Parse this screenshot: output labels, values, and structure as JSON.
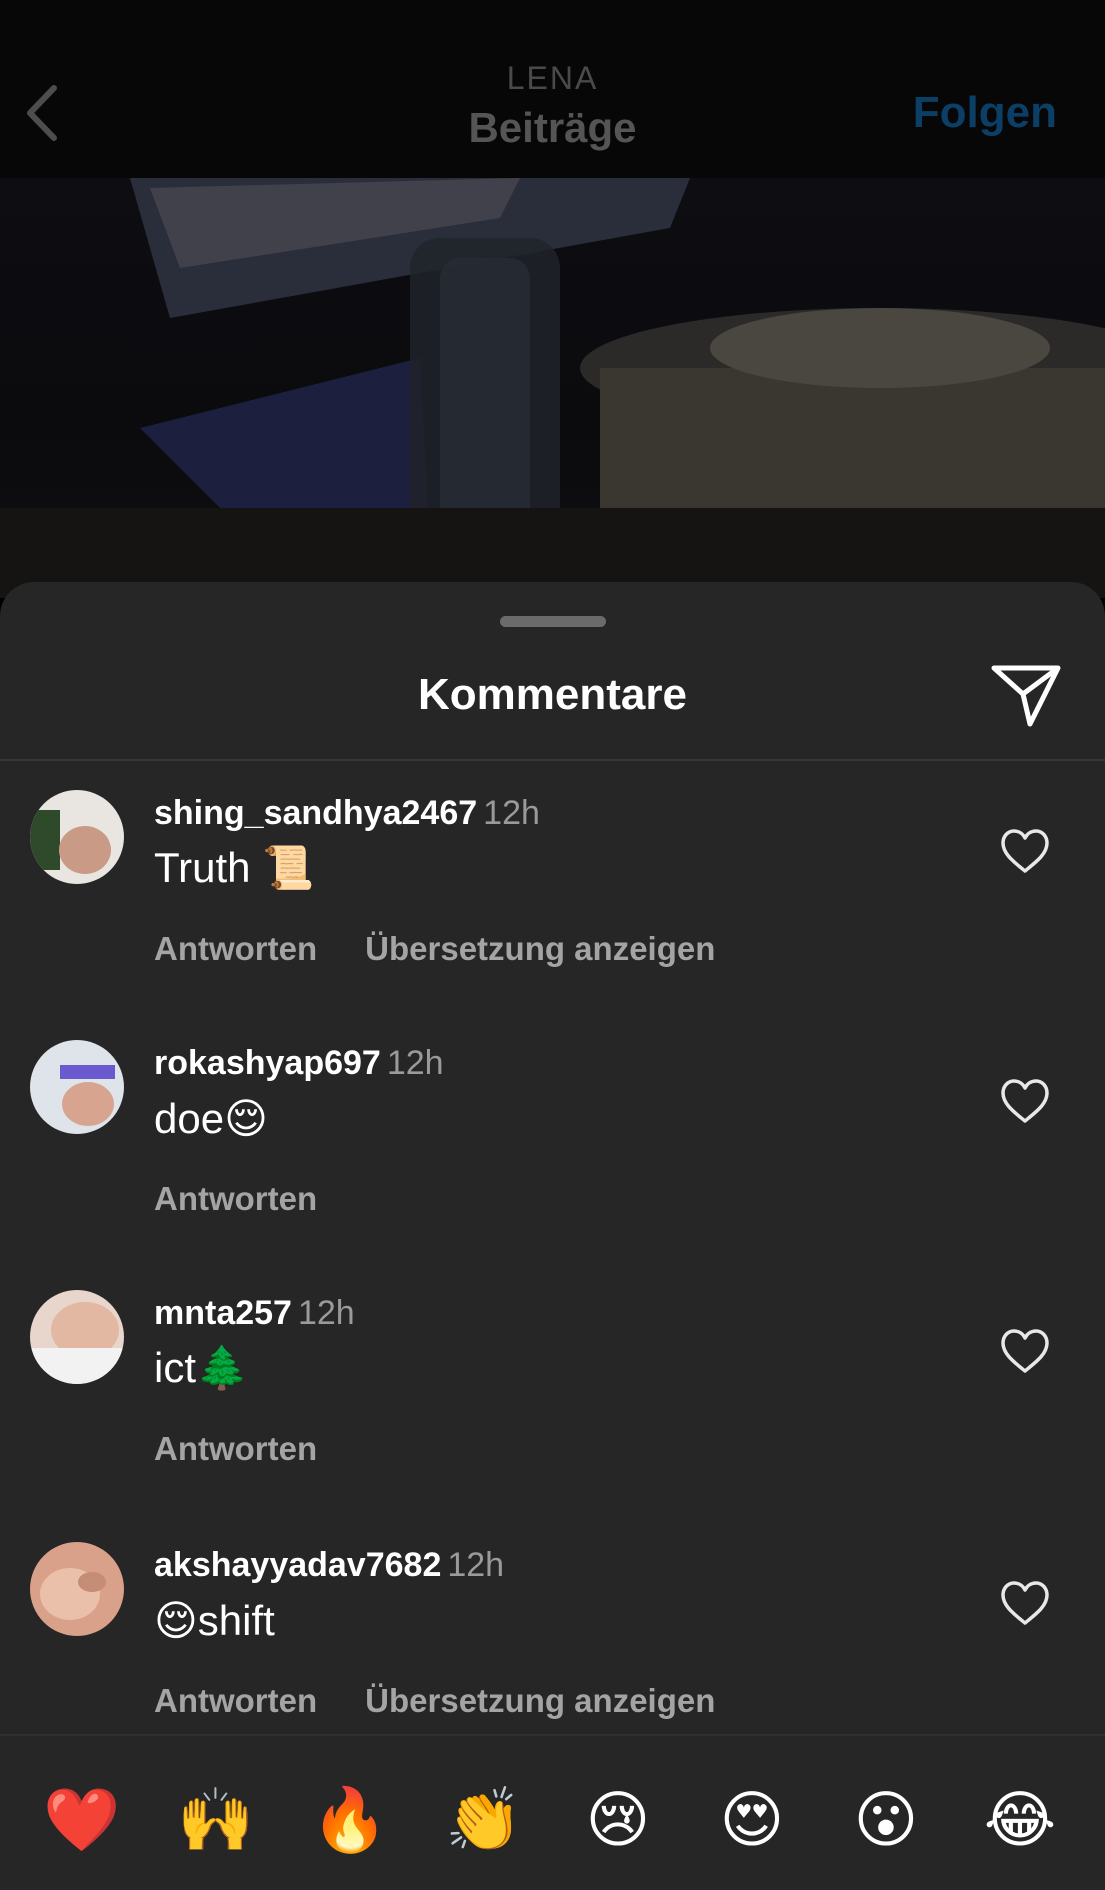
{
  "header": {
    "subtitle": "LENA",
    "title": "Beiträge",
    "follow_label": "Folgen"
  },
  "sheet": {
    "title": "Kommentare"
  },
  "comments": [
    {
      "user": "shing_sandhya2467",
      "time": "12h",
      "text": "Truth 📜",
      "reply": "Antworten",
      "translate": "Übersetzung anzeigen"
    },
    {
      "user": "rokashyap697",
      "time": "12h",
      "text": "doe😌",
      "reply": "Antworten"
    },
    {
      "user": "mnta257",
      "time": "12h",
      "text": "ict🌲",
      "reply": "Antworten"
    },
    {
      "user": "akshayyadav7682",
      "time": "12h",
      "text": "😌shift",
      "reply": "Antworten",
      "translate": "Übersetzung anzeigen"
    }
  ],
  "reactions": [
    "❤️",
    "🙌",
    "🔥",
    "👏",
    "😢",
    "😍",
    "😮",
    "😂"
  ],
  "icons": {
    "back": "chevron-left-icon",
    "share": "paper-plane-icon",
    "like": "heart-outline-icon"
  }
}
